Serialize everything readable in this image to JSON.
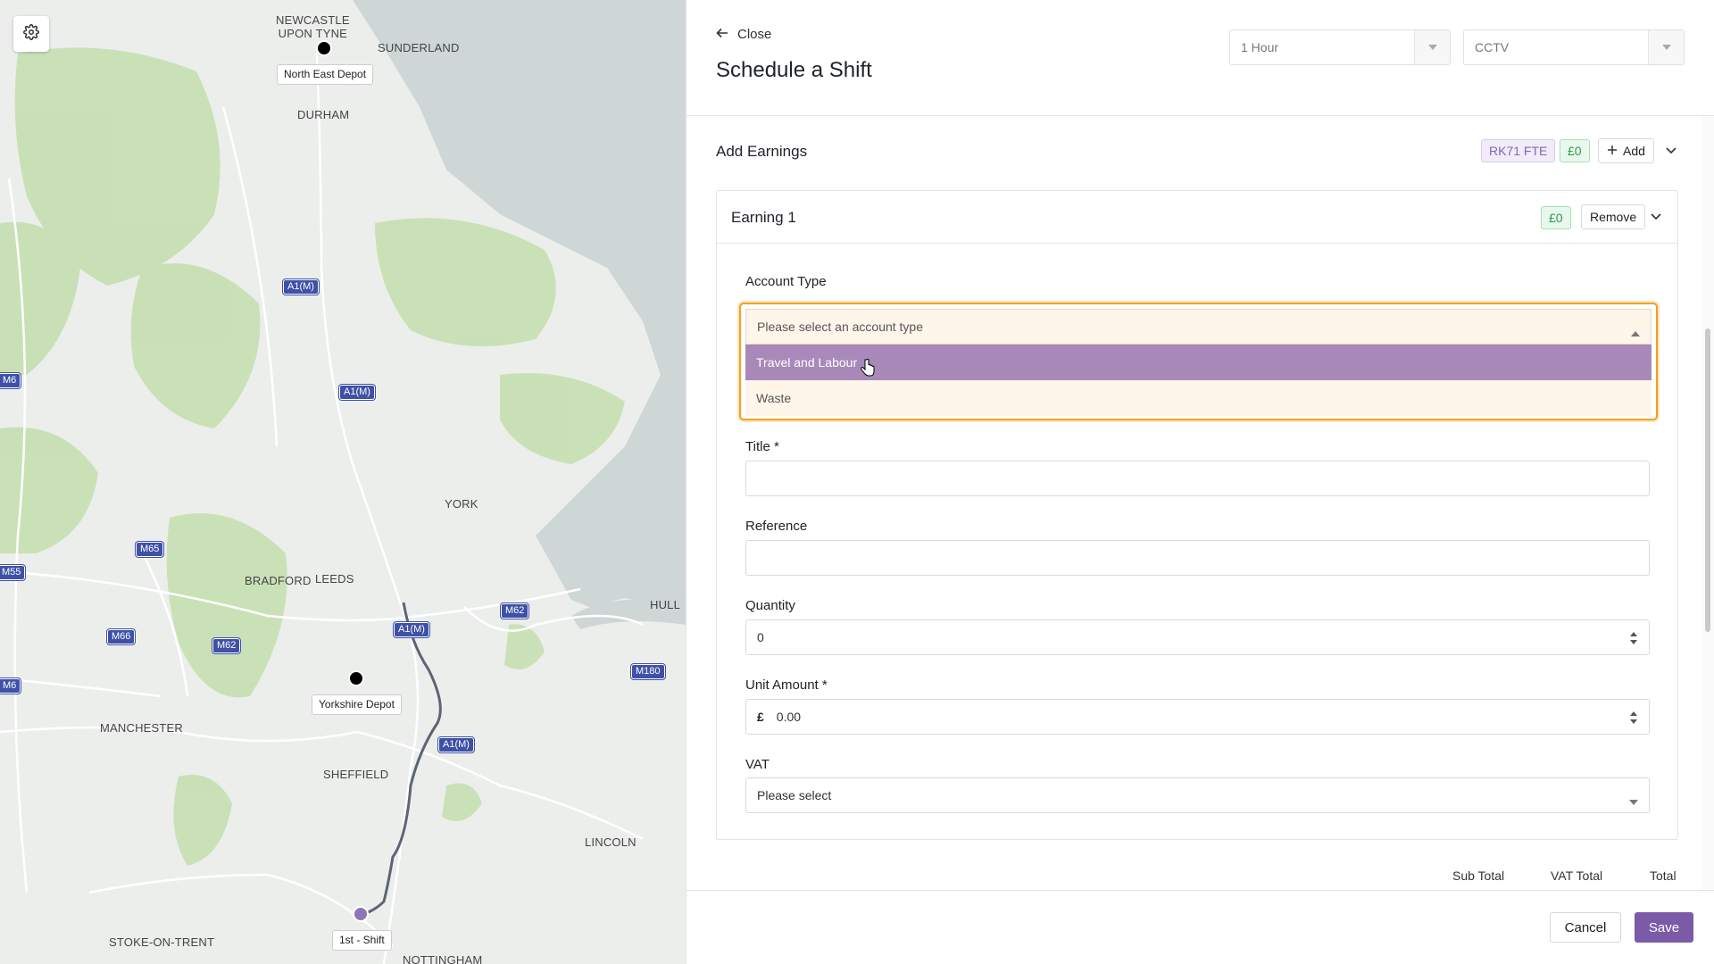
{
  "map": {
    "places": [
      {
        "id": "newcastle",
        "label": "NEWCASTLE\nUPON TYNE"
      },
      {
        "id": "sunderland",
        "label": "SUNDERLAND"
      },
      {
        "id": "durham",
        "label": "DURHAM"
      },
      {
        "id": "york",
        "label": "YORK"
      },
      {
        "id": "bradford",
        "label": "BRADFORD"
      },
      {
        "id": "leeds",
        "label": "LEEDS"
      },
      {
        "id": "hull",
        "label": "HULL"
      },
      {
        "id": "manchester",
        "label": "MANCHESTER"
      },
      {
        "id": "sheffield",
        "label": "SHEFFIELD"
      },
      {
        "id": "lincoln",
        "label": "LINCOLN"
      },
      {
        "id": "stoke",
        "label": "STOKE-ON-TRENT"
      },
      {
        "id": "nottingham",
        "label": "NOTTINGHAM"
      }
    ],
    "roads": [
      "A1(M)",
      "A1(M)",
      "M6",
      "M55",
      "M65",
      "M66",
      "M62",
      "A1(M)",
      "M62",
      "M180",
      "M6",
      "A1(M)"
    ],
    "markers": [
      {
        "label": "North East Depot",
        "color": "#000000"
      },
      {
        "label": "Yorkshire Depot",
        "color": "#000000"
      },
      {
        "label": "1st - Shift",
        "color": "#8e75b8"
      }
    ],
    "settings_icon": "gear-icon"
  },
  "header": {
    "close_label": "Close",
    "title": "Schedule a Shift",
    "duration_select": "1 Hour",
    "type_select": "CCTV"
  },
  "earnings": {
    "section_title": "Add Earnings",
    "vehicle_badge": "RK71 FTE",
    "total_badge": "£0",
    "add_label": "Add",
    "card": {
      "title": "Earning 1",
      "amount_badge": "£0",
      "remove_label": "Remove",
      "account_type": {
        "label": "Account Type",
        "placeholder": "Please select an account type",
        "options": [
          "Travel and Labour",
          "Waste"
        ],
        "highlighted": "Travel and Labour"
      },
      "title_field": {
        "label": "Title *",
        "value": ""
      },
      "reference_field": {
        "label": "Reference",
        "value": ""
      },
      "quantity_field": {
        "label": "Quantity",
        "value": "0"
      },
      "unit_amount_field": {
        "label": "Unit Amount *",
        "currency": "£",
        "value": "0.00"
      },
      "vat_field": {
        "label": "VAT",
        "value": "Please select"
      }
    },
    "totals": {
      "sub_total": "Sub Total",
      "vat_total": "VAT Total",
      "total": "Total"
    }
  },
  "footer": {
    "cancel_label": "Cancel",
    "save_label": "Save"
  },
  "colors": {
    "accent": "#7b5ba7",
    "highlight_option": "#a889b9",
    "focus_border": "#f0a020",
    "green_badge": "#2c9a4a"
  }
}
